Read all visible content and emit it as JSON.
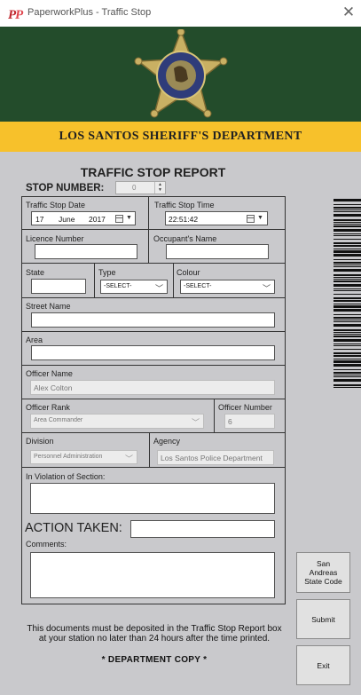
{
  "window": {
    "title": "PaperworkPlus - Traffic Stop",
    "close_glyph": "✕",
    "app_icon": "pp-logo-icon"
  },
  "header": {
    "department": "LOS SANTOS SHERIFF'S DEPARTMENT",
    "badge_icon": "sheriff-star-badge-icon",
    "colors": {
      "green": "#234c2b",
      "yellow": "#f7c12b",
      "background": "#c9c9cc"
    }
  },
  "report": {
    "title": "TRAFFIC STOP REPORT",
    "stop_number_label": "STOP NUMBER:",
    "stop_number_value": "0"
  },
  "fields": {
    "stop_date_label": "Traffic Stop Date",
    "stop_date_day": "17",
    "stop_date_month": "June",
    "stop_date_year": "2017",
    "stop_time_label": "Traffic Stop Time",
    "stop_time_value": "22:51:42",
    "licence_label": "Licence Number",
    "licence_value": "",
    "occupant_label": "Occupant's Name",
    "occupant_value": "",
    "state_label": "State",
    "state_value": "",
    "type_label": "Type",
    "type_value": "-SELECT-",
    "colour_label": "Colour",
    "colour_value": "-SELECT-",
    "street_label": "Street Name",
    "street_value": "",
    "area_label": "Area",
    "area_value": "",
    "officer_name_label": "Officer Name",
    "officer_name_value": "Alex Colton",
    "officer_rank_label": "Officer Rank",
    "officer_rank_value": "Area Commander",
    "officer_number_label": "Officer Number",
    "officer_number_value": "6",
    "division_label": "Division",
    "division_value": "Personnel Administration",
    "agency_label": "Agency",
    "agency_value": "Los Santos Police Department",
    "violation_label": "In Violation of Section:",
    "violation_value": "",
    "action_label": "ACTION TAKEN:",
    "action_value": "",
    "comments_label": "Comments:",
    "comments_value": ""
  },
  "buttons": {
    "state_code": "San Andreas State Code",
    "submit": "Submit",
    "exit": "Exit"
  },
  "footer": {
    "note": "This documents must be deposited in the Traffic Stop Report box at your station no later than 24 hours after the time printed.",
    "copy": "*  DEPARTMENT COPY  *"
  }
}
